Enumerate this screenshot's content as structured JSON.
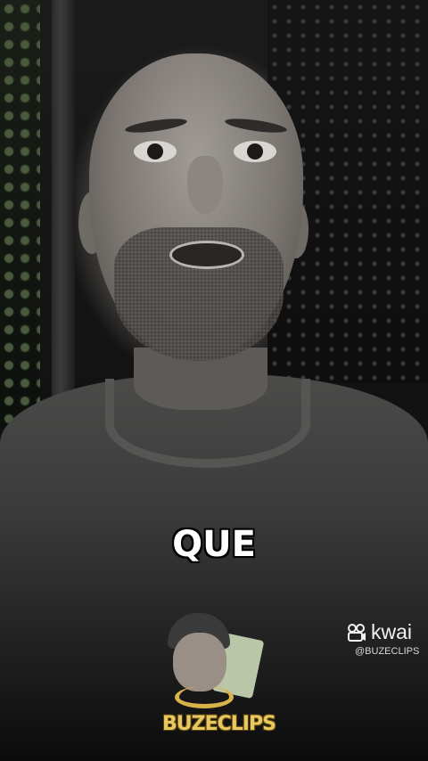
{
  "caption": {
    "text": "QUE"
  },
  "watermark": {
    "platform": "kwai",
    "handle": "@BUZECLIPS",
    "icon": "kwai-logo-icon"
  },
  "channel_logo": {
    "text": "BUZECLIPS",
    "icon": "mascot-icon"
  },
  "colors": {
    "caption_text": "#ffffff",
    "brand_gold": "#e9c861",
    "watermark_text": "#f2f2f2"
  }
}
